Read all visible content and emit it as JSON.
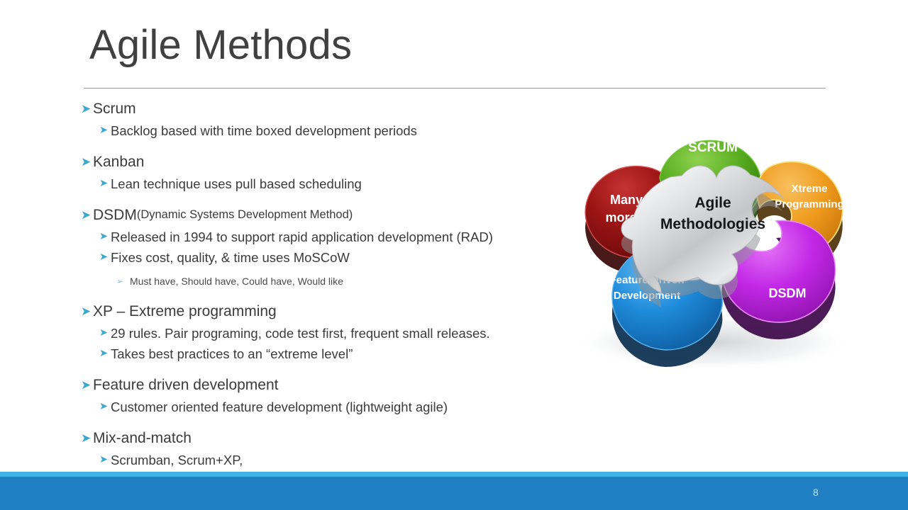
{
  "slide": {
    "title": "Agile Methods",
    "page_number": "8",
    "accent_color": "#2180c4",
    "accent_light_color": "#3fb3e3",
    "bullet_marker_color": "#3ca8cc",
    "title_color": "#404040",
    "body_text_color": "#3b3b3b",
    "bullet_glyph": "➤",
    "bullet_glyph_sub": "➢"
  },
  "outline": [
    {
      "level": 1,
      "text": "Scrum"
    },
    {
      "level": 2,
      "text": "Backlog based with time boxed development periods"
    },
    {
      "level": 1,
      "text": "Kanban"
    },
    {
      "level": 2,
      "text": "Lean technique uses pull based scheduling"
    },
    {
      "level": 1,
      "text": "DSDM",
      "note": "(Dynamic Systems Development Method)"
    },
    {
      "level": 2,
      "text": "Released in 1994 to support rapid application development (RAD)"
    },
    {
      "level": 2,
      "text": "Fixes cost, quality, & time uses MoSCoW"
    },
    {
      "level": 3,
      "text": "Must have, Should have, Could have, Would like"
    },
    {
      "level": 1,
      "text": "XP – Extreme programming"
    },
    {
      "level": 2,
      "text": "29 rules.  Pair programing, code test first, frequent small releases."
    },
    {
      "level": 2,
      "text": "Takes best practices to an “extreme level”"
    },
    {
      "level": 1,
      "text": "Feature driven development"
    },
    {
      "level": 2,
      "text": "Customer oriented feature development (lightweight agile)"
    },
    {
      "level": 1,
      "text": "Mix-and-match"
    },
    {
      "level": 2,
      "text": "Scrumban, Scrum+XP,"
    }
  ],
  "diagram": {
    "name": "agile-methodologies-puzzle",
    "center": {
      "label_line1": "Agile",
      "label_line2": "Methodologies",
      "color": "#cfd0d2"
    },
    "pieces": [
      {
        "id": "scrum",
        "label_line1": "SCRUM",
        "label_line2": "",
        "color": "#4a9e1c",
        "dark": "#2f6b10"
      },
      {
        "id": "xp",
        "label_line1": "Xtreme",
        "label_line2": "Programming",
        "color": "#e8911a",
        "dark": "#9a5c06"
      },
      {
        "id": "dsdm",
        "label_line1": "DSDM",
        "label_line2": "",
        "color": "#bd1ee0",
        "dark": "#5f1070"
      },
      {
        "id": "fdd",
        "label_line1": "Feature Driven",
        "label_line2": "Development",
        "color": "#1a86d8",
        "dark": "#0d4d80"
      },
      {
        "id": "many",
        "label_line1": "Many",
        "label_line2": "more...",
        "color": "#9e1414",
        "dark": "#560b0b"
      }
    ]
  }
}
